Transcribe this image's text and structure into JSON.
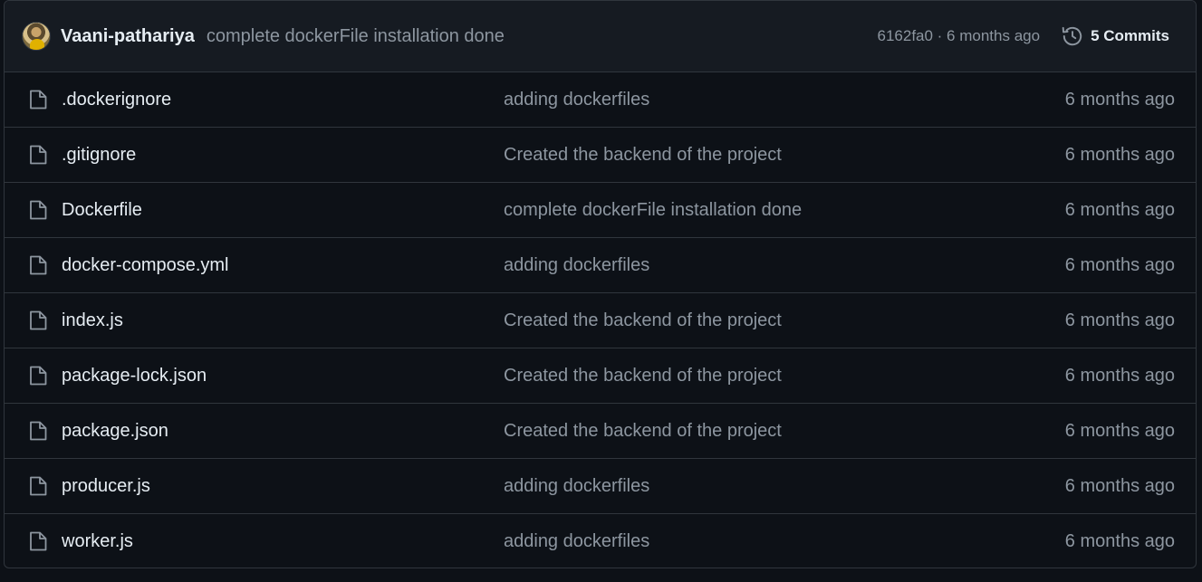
{
  "latest_commit": {
    "author": "Vaani-pathariya",
    "message": "complete dockerFile installation done",
    "sha_time": "6162fa0 · 6 months ago",
    "commits_label": "5 Commits"
  },
  "files": [
    {
      "name": ".dockerignore",
      "message": "adding dockerfiles",
      "time": "6 months ago"
    },
    {
      "name": ".gitignore",
      "message": "Created the backend of the project",
      "time": "6 months ago"
    },
    {
      "name": "Dockerfile",
      "message": "complete dockerFile installation done",
      "time": "6 months ago"
    },
    {
      "name": "docker-compose.yml",
      "message": "adding dockerfiles",
      "time": "6 months ago"
    },
    {
      "name": "index.js",
      "message": "Created the backend of the project",
      "time": "6 months ago"
    },
    {
      "name": "package-lock.json",
      "message": "Created the backend of the project",
      "time": "6 months ago"
    },
    {
      "name": "package.json",
      "message": "Created the backend of the project",
      "time": "6 months ago"
    },
    {
      "name": "producer.js",
      "message": "adding dockerfiles",
      "time": "6 months ago"
    },
    {
      "name": "worker.js",
      "message": "adding dockerfiles",
      "time": "6 months ago"
    }
  ],
  "icons": {
    "file": "file-icon",
    "history": "history-icon"
  },
  "colors": {
    "background": "#0d1117",
    "header_background": "#161b22",
    "border": "#30363d",
    "text_primary": "#e6edf3",
    "text_muted": "#8d96a0"
  }
}
